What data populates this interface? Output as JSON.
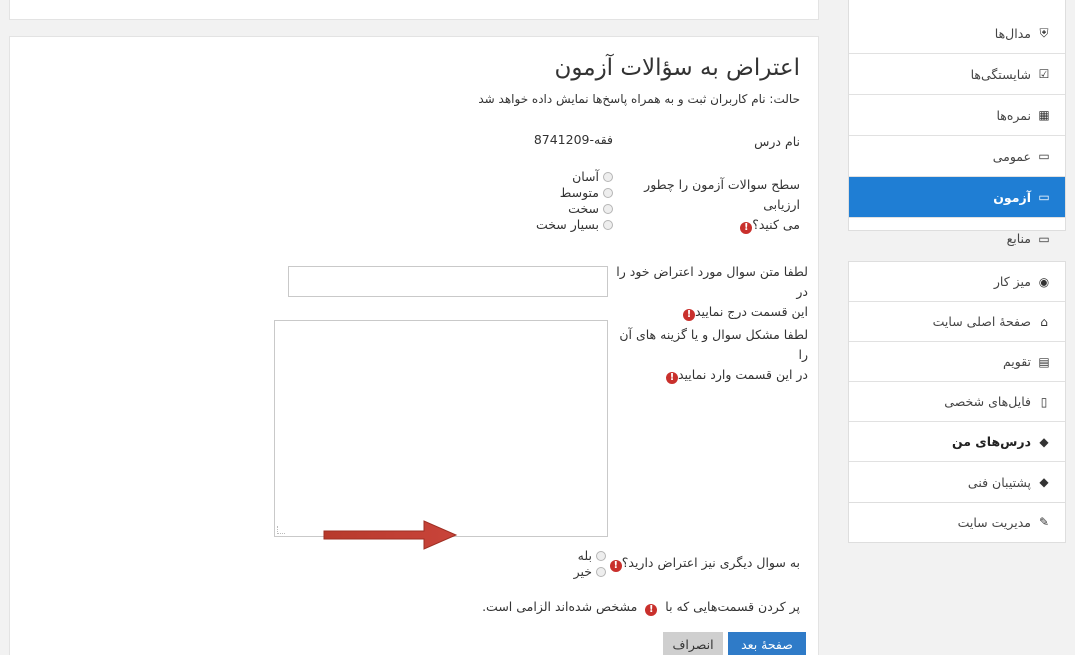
{
  "main": {
    "title": "اعتراض به سؤالات آزمون",
    "status": "حالت: نام کاربران ثبت و به همراه پاسخ‌ها نمایش داده خواهد شد",
    "course_name_label": "نام درس",
    "course_name_value": "فقه-8741209",
    "q1": {
      "label_line1": "سطح سوالات آزمون را چطور ارزیابی",
      "label_line2": "می کنید؟",
      "options": [
        "آسان",
        "متوسط",
        "سخت",
        "بسیار سخت"
      ]
    },
    "q2": {
      "label_line1": "لطفا متن سوال مورد اعتراض خود را در",
      "label_line2": "این قسمت درج نمایید"
    },
    "q3": {
      "label_line1": "لطفا مشکل سوال و یا گزینه های آن را",
      "label_line2": "در این قسمت وارد نمایید"
    },
    "q4": {
      "label": "به سوال دیگری نیز اعتراض دارید؟",
      "options": [
        "بله",
        "خیر"
      ]
    },
    "required_note_before": "پر کردن قسمت‌هایی که با",
    "required_note_after": "مشخص شده‌اند الزامی است.",
    "required_icon": "!",
    "next_button": "صفحهٔ بعد",
    "cancel_button": "انصراف"
  },
  "sidebar": {
    "course_items": [
      {
        "label": "مدال‌ها",
        "icon": "shield-icon",
        "glyph": "⛨"
      },
      {
        "label": "شایستگی‌ها",
        "icon": "checkbox-icon",
        "glyph": "☑"
      },
      {
        "label": "نمره‌ها",
        "icon": "table-icon",
        "glyph": "▦"
      },
      {
        "label": "عمومی",
        "icon": "folder-icon",
        "glyph": "▭"
      },
      {
        "label": "آزمون",
        "icon": "folder-icon",
        "glyph": "▭"
      },
      {
        "label": "منابع",
        "icon": "folder-icon",
        "glyph": "▭"
      }
    ],
    "nav_items": [
      {
        "label": "میز کار",
        "icon": "dashboard-icon",
        "glyph": "◉"
      },
      {
        "label": "صفحهٔ اصلی سایت",
        "icon": "home-icon",
        "glyph": "⌂"
      },
      {
        "label": "تقویم",
        "icon": "calendar-icon",
        "glyph": "▤"
      },
      {
        "label": "فایل‌های شخصی",
        "icon": "file-icon",
        "glyph": "▯"
      },
      {
        "label": "درس‌های من",
        "icon": "graduation-cap-icon",
        "glyph": "◆"
      },
      {
        "label": "پشتیبان فنی",
        "icon": "graduation-cap-icon",
        "glyph": "◆"
      }
    ],
    "admin_item": {
      "label": "مدیریت سایت",
      "icon": "wrench-icon",
      "glyph": "✎"
    }
  },
  "colors": {
    "accent": "#1f7ed4",
    "required": "#c9302c",
    "arrow": "#c0392b"
  }
}
